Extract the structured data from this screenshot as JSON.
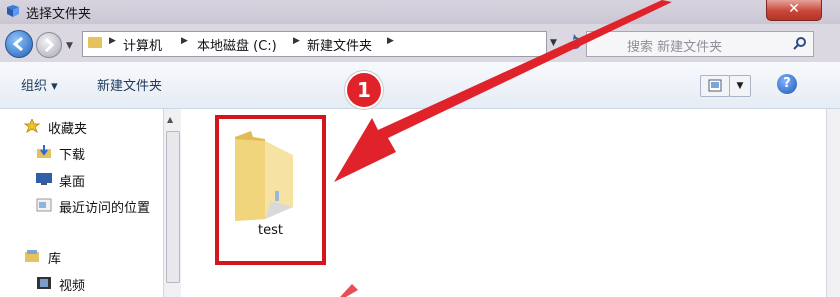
{
  "window": {
    "title": "选择文件夹",
    "close_glyph": "✕"
  },
  "address": {
    "crumbs": [
      "计算机",
      "本地磁盘 (C:)",
      "新建文件夹"
    ],
    "search_placeholder": "搜索 新建文件夹"
  },
  "toolbar": {
    "organize_label": "组织 ▾",
    "new_folder_label": "新建文件夹",
    "help_glyph": "?"
  },
  "navigation": {
    "favorites": {
      "label": "收藏夹",
      "items": [
        "下载",
        "桌面",
        "最近访问的位置"
      ]
    },
    "libraries": {
      "label": "库",
      "items": [
        "视频"
      ]
    }
  },
  "content": {
    "items": [
      {
        "name": "test",
        "type": "folder"
      }
    ]
  },
  "annotation": {
    "step_number": "1",
    "color": "#e0232a"
  }
}
